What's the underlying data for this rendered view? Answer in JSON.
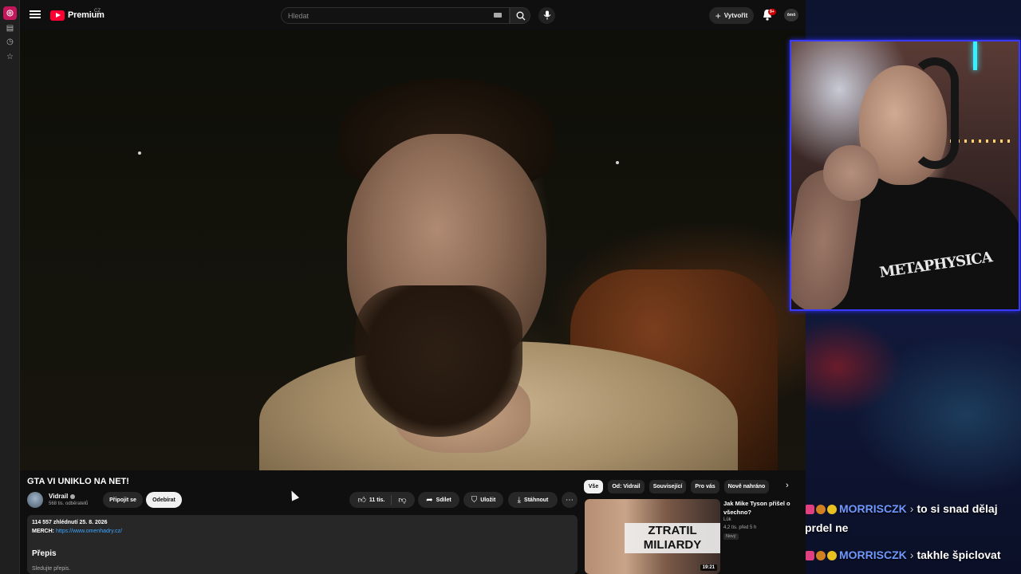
{
  "topbar": {
    "logo_text": "Premium",
    "region": "CZ",
    "search_placeholder": "Hledat",
    "create_label": "Vytvořit",
    "notifications_badge": "9+",
    "account_avatar_text": "ômō"
  },
  "video": {
    "title": "GTA VI UNIKLO NA NET!"
  },
  "channel": {
    "name": "Vidrail",
    "subscribers": "568 tis. odběratelů",
    "join_label": "Připojit se",
    "subscribe_label": "Odebírat"
  },
  "actions": {
    "likes": "11 tis.",
    "share_label": "Sdílet",
    "save_label": "Uložit",
    "download_label": "Stáhnout"
  },
  "description": {
    "meta": "114 557 zhlédnutí  25. 8. 2026",
    "merch_label": "MERCH:",
    "merch_url": "https://www.omenhadry.cz/",
    "section_heading": "Přepis",
    "section_sub": "Sledujte přepis."
  },
  "chips": [
    "Vše",
    "Od: Vidrail",
    "Související",
    "Pro vás",
    "Nově nahráno"
  ],
  "recommendation": {
    "thumb_text": "ZTRATIL MILIARDY",
    "duration": "19:21",
    "title": "Jak Mike Tyson přišel o všechno?",
    "channel": "Lük",
    "meta": "4,2 tis.  před 5 h",
    "badge": "Nový"
  },
  "webcam": {
    "shirt_print": "METAPHYSICA"
  },
  "chat": [
    {
      "user": "MORRISCZK",
      "message": "to si snad dělaj prdel ne"
    },
    {
      "user": "MORRISCZK",
      "message": "takhle špiclovat"
    }
  ],
  "icons": {
    "menu": "menu-icon",
    "search": "search-icon",
    "mic": "mic-icon",
    "bell": "bell-icon",
    "like": "thumb-up-icon",
    "dislike": "thumb-down-icon",
    "share": "share-icon",
    "save": "bookmark-icon",
    "download": "download-icon",
    "more": "more-icon"
  },
  "colors": {
    "accent_red": "#ff0033",
    "link_blue": "#3ea6ff",
    "chat_user": "#6f98ff",
    "webcam_border": "#3a3aff"
  }
}
